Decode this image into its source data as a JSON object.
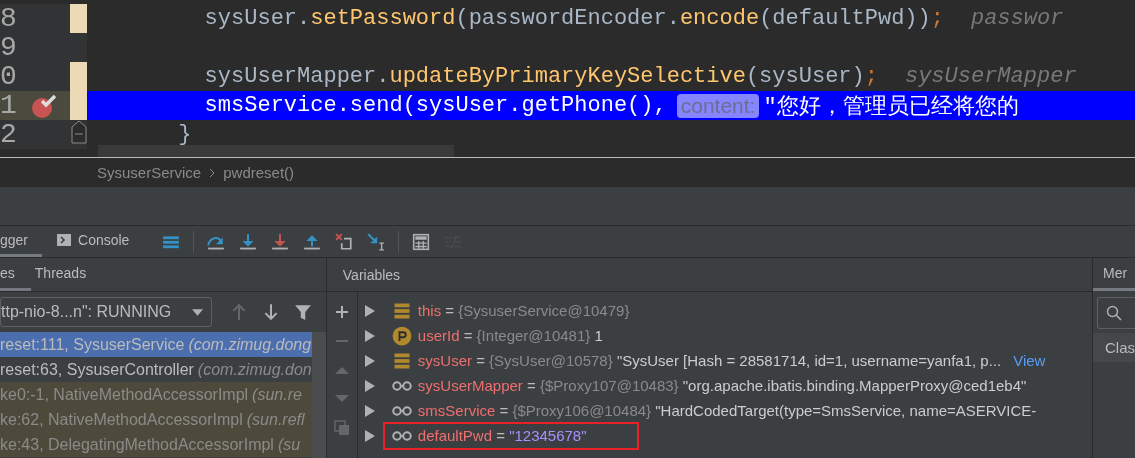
{
  "editor": {
    "lines": [
      {
        "number": "8",
        "breakpoint": false,
        "current": false,
        "changed": true,
        "fold_marker": false,
        "segments": [
          {
            "kind": "code",
            "tokens": [
              {
                "kind": "plain",
                "text": "        sysUser."
              },
              {
                "kind": "method",
                "text": "setPassword"
              },
              {
                "kind": "plain",
                "text": "(passwordEncoder."
              },
              {
                "kind": "method",
                "text": "encode"
              },
              {
                "kind": "plain",
                "text": "(defaultPwd))"
              },
              {
                "kind": "semi",
                "text": ";"
              }
            ]
          },
          {
            "kind": "inline_value",
            "text": "passwor"
          }
        ]
      },
      {
        "number": "9",
        "breakpoint": false,
        "current": false,
        "changed": false,
        "fold_marker": false
      },
      {
        "number": "0",
        "breakpoint": false,
        "current": false,
        "changed": true,
        "fold_marker": false,
        "segments": [
          {
            "kind": "code",
            "tokens": [
              {
                "kind": "plain",
                "text": "        sysUserMapper."
              },
              {
                "kind": "method",
                "text": "updateByPrimaryKeySelective"
              },
              {
                "kind": "plain",
                "text": "(sysUser)"
              },
              {
                "kind": "semi",
                "text": ";"
              }
            ]
          },
          {
            "kind": "inline_value",
            "text": "sysUserMapper"
          }
        ]
      },
      {
        "number": "1",
        "breakpoint": true,
        "current": true,
        "changed": true,
        "fold_marker": false,
        "segments": [
          {
            "kind": "code",
            "tokens": [
              {
                "kind": "plain",
                "text": "        smsService."
              },
              {
                "kind": "method",
                "text": "send"
              },
              {
                "kind": "plain",
                "text": "(sysUser."
              },
              {
                "kind": "method",
                "text": "getPhone"
              },
              {
                "kind": "plain",
                "text": "(),"
              }
            ]
          },
          {
            "kind": "param_hint",
            "text": "content:"
          },
          {
            "kind": "code",
            "tokens": [
              {
                "kind": "string",
                "text": "″您好，管理员已经将您的"
              }
            ]
          }
        ]
      },
      {
        "number": "2",
        "breakpoint": false,
        "current": false,
        "changed": false,
        "fold_marker": true,
        "segments": [
          {
            "kind": "code",
            "tokens": [
              {
                "kind": "plain",
                "text": "      }"
              }
            ]
          }
        ]
      }
    ]
  },
  "breadcrumb": [
    "SysuserService",
    "pwdreset()"
  ],
  "toolbar": {
    "tabs": [
      {
        "label": "gger",
        "selected": true
      },
      {
        "label": "Console",
        "selected": false
      }
    ],
    "buttons": [
      {
        "disabled": false
      },
      {
        "disabled": false
      },
      {
        "disabled": false
      },
      {
        "disabled": false
      },
      {
        "disabled": false
      },
      {
        "disabled": false
      },
      {
        "disabled": false
      },
      {
        "disabled": false
      },
      {
        "disabled": true
      }
    ]
  },
  "frames_panel": {
    "tabs": [
      {
        "label": "es",
        "selected": true
      },
      {
        "label": "Threads",
        "selected": false
      }
    ],
    "thread": "ttp-nio-8...n\": RUNNING",
    "nav": [
      {
        "disabled": true
      },
      {
        "disabled": false
      },
      {
        "disabled": false
      }
    ],
    "frames": [
      {
        "method": "reset:111, SysuserService",
        "package": "(com.zimug.dong",
        "selected": true,
        "library": false
      },
      {
        "method": "reset:63, SysuserController",
        "package": "(com.zimug.don",
        "selected": false,
        "library": false
      },
      {
        "method": "ke0:-1, NativeMethodAccessorImpl",
        "package": "(sun.re",
        "selected": false,
        "library": true
      },
      {
        "method": "ke:62, NativeMethodAccessorImpl",
        "package": "(sun.refl",
        "selected": false,
        "library": true
      },
      {
        "method": "ke:43, DelegatingMethodAccessorImpl",
        "package": "(su",
        "selected": false,
        "library": true
      }
    ]
  },
  "variables_panel": {
    "title": "Variables",
    "side_buttons": [
      {
        "disabled": false
      },
      {
        "disabled": true
      },
      {
        "disabled": true
      },
      {
        "disabled": true
      },
      {
        "disabled": true
      }
    ],
    "variables": [
      {
        "kind": "field",
        "name": "this",
        "equals": "=",
        "type": "{SysuserService@10479}",
        "outlined": false
      },
      {
        "kind": "param",
        "name": "userId",
        "equals": "=",
        "type": "{Integer@10481}",
        "value": "1",
        "outlined": false
      },
      {
        "kind": "field",
        "name": "sysUser",
        "equals": "=",
        "type": "{SysUser@10578}",
        "value": "\"SysUser [Hash = 28581714, id=1, username=yanfa1, p...",
        "link": "View",
        "outlined": false
      },
      {
        "kind": "watch",
        "name": "sysUserMapper",
        "equals": "=",
        "type": "{$Proxy107@10483}",
        "value": "\"org.apache.ibatis.binding.MapperProxy@ced1eb4\"",
        "outlined": false
      },
      {
        "kind": "watch",
        "name": "smsService",
        "equals": "=",
        "type": "{$Proxy106@10484}",
        "value": "\"HardCodedTarget(type=SmsService, name=ASERVICE-",
        "outlined": false
      },
      {
        "kind": "watch",
        "name": "defaultPwd",
        "equals": "=",
        "value": "\"12345678\"",
        "outlined": true
      }
    ]
  },
  "memory_panel": {
    "tab": "Mer",
    "column": "Clas"
  }
}
